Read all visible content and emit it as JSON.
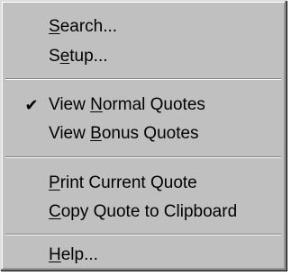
{
  "menu": {
    "items": [
      {
        "pre": "",
        "accel": "S",
        "post": "earch...",
        "checked": false
      },
      {
        "pre": "S",
        "accel": "e",
        "post": "tup...",
        "checked": false
      },
      {
        "pre": "View ",
        "accel": "N",
        "post": "ormal Quotes",
        "checked": true
      },
      {
        "pre": "View ",
        "accel": "B",
        "post": "onus Quotes",
        "checked": false
      },
      {
        "pre": "",
        "accel": "P",
        "post": "rint Current Quote",
        "checked": false
      },
      {
        "pre": "",
        "accel": "C",
        "post": "opy Quote to Clipboard",
        "checked": false
      },
      {
        "pre": "",
        "accel": "H",
        "post": "elp...",
        "checked": false
      }
    ],
    "check_glyph": "✔"
  }
}
